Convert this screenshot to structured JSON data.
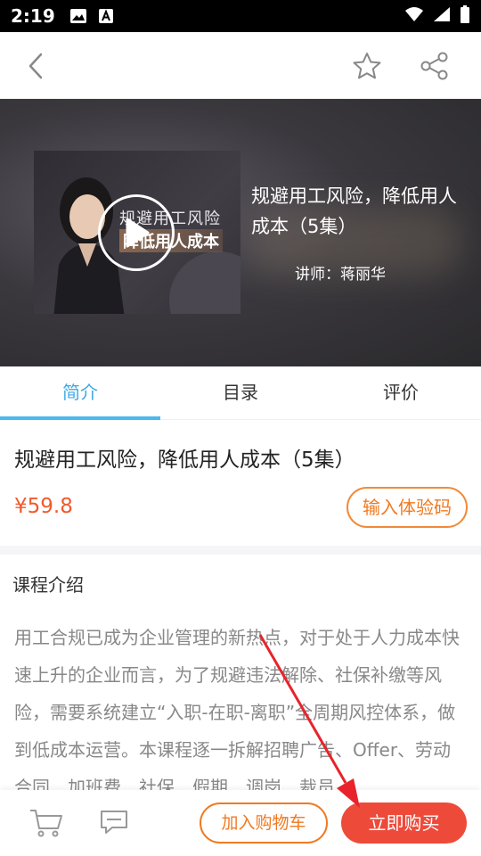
{
  "status_bar": {
    "time": "2:19",
    "icons_left": [
      "image-icon",
      "a-icon"
    ],
    "icons_right": [
      "wifi-icon",
      "signal-icon",
      "battery-icon"
    ]
  },
  "header": {
    "back_icon": "chevron-left-icon",
    "favorite_icon": "star-outline-icon",
    "share_icon": "share-icon"
  },
  "hero": {
    "thumbnail_title": "规避用工风险",
    "thumbnail_subtitle": "降低用人成本",
    "title": "规避用工风险，降低用人成本（5集）",
    "teacher": "讲师：蒋丽华"
  },
  "tabs": [
    {
      "label": "简介",
      "active": true
    },
    {
      "label": "目录",
      "active": false
    },
    {
      "label": "评价",
      "active": false
    }
  ],
  "course": {
    "title": "规避用工风险，降低用人成本（5集）",
    "price": "¥59.8",
    "trial_label": "输入体验码"
  },
  "intro": {
    "heading": "课程介绍",
    "text": "用工合规已成为企业管理的新热点，对于处于人力成本快速上升的企业而言，为了规避违法解除、社保补缴等风险，需要系统建立“入职-在职-离职”全周期风控体系，做到低成本运营。本课程逐一拆解招聘广告、Offer、劳动合同、加班费、社保、假期、调岗、裁员"
  },
  "bottom_bar": {
    "add_cart_label": "加入购物车",
    "buy_label": "立即购买"
  },
  "colors": {
    "accent_blue": "#3fa9e6",
    "price_orange": "#f05a2d",
    "outline_orange": "#f07a22",
    "buy_red": "#ee4a3a",
    "annotation_red": "#e8232b"
  }
}
